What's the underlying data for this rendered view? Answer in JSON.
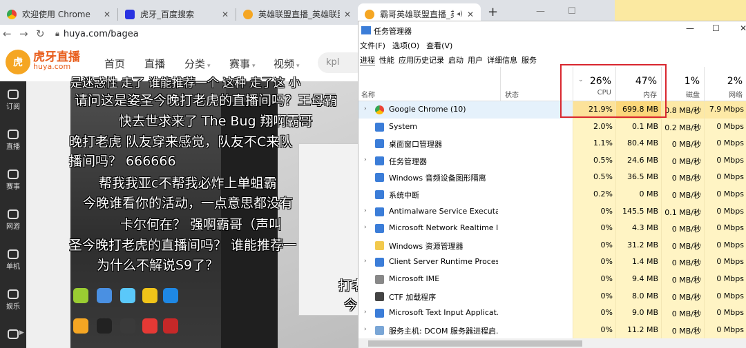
{
  "chrome": {
    "tabs": [
      {
        "title": "欢迎使用 Chrome",
        "icon": "chrome-icon",
        "color": "#4285f4"
      },
      {
        "title": "虎牙_百度搜索",
        "icon": "baidu-paw-icon",
        "color": "#2932e1"
      },
      {
        "title": "英雄联盟直播_英雄联盟え",
        "icon": "huya-icon",
        "color": "#f5a623"
      },
      {
        "title": "霸哥英雄联盟直播_英",
        "icon": "huya-icon",
        "color": "#f5a623",
        "active": true
      }
    ],
    "close": "✕",
    "new_tab": "+",
    "mute_icon": "◂)",
    "address": "huya.com/bagea",
    "window_min": "—",
    "window_max": "☐"
  },
  "huya": {
    "logo_badge": "虎",
    "logo_cn": "虎牙直播",
    "logo_en": "huya.com",
    "nav": [
      {
        "label": "首页"
      },
      {
        "label": "直播"
      },
      {
        "label": "分类",
        "caret": true
      },
      {
        "label": "赛事",
        "caret": true
      },
      {
        "label": "视频",
        "caret": true
      }
    ],
    "caret": "▾",
    "search_text": "kpl",
    "sidebar": [
      {
        "label": "订阅"
      },
      {
        "label": "直播"
      },
      {
        "label": "赛事"
      },
      {
        "label": "网游"
      },
      {
        "label": "单机"
      },
      {
        "label": "娱乐"
      },
      {
        "label": ""
      }
    ],
    "danmaku": [
      "是迷惑性   走了     谁能推荐一个 这种 走了这        小",
      "请问这是姿圣今晚打老虎的直播间吗？王母霸",
      "快去世求来了      The Bug  翔啊霸哥",
      "晚打老虎      队友穿来感觉，队友不C来队",
      "播间吗？                       666666",
      "帮我我亚c不帮我必炸上单蛆霸",
      "今晚谁看你的活动，一点意思都没有",
      "卡尔何在？          强啊霸哥（声叫",
      "圣今晚打老虎的直播间吗？       谁能推荐一",
      "为什么不解说S9了？",
      "打老",
      "今"
    ]
  },
  "taskmgr": {
    "title": "任务管理器",
    "window_buttons": [
      "—",
      "☐",
      "✕"
    ],
    "menu": [
      "文件(F)",
      "选项(O)",
      "查看(V)"
    ],
    "tabs": [
      "进程",
      "性能",
      "应用历史记录",
      "启动",
      "用户",
      "详细信息",
      "服务"
    ],
    "columns": {
      "name": "名称",
      "status": "状态",
      "sort_indicator": "⌄",
      "cpu": {
        "pct": "26%",
        "label": "CPU"
      },
      "mem": {
        "pct": "47%",
        "label": "内存"
      },
      "disk": {
        "pct": "1%",
        "label": "磁盘"
      },
      "net": {
        "pct": "2%",
        "label": "网络"
      }
    },
    "highlight_color": "#d9262e",
    "rows": [
      {
        "name": "Google Chrome (10)",
        "expand": "›",
        "icon": "chrome-icon",
        "cpu": "21.9%",
        "mem": "699.8 MB",
        "disk": "0.8 MB/秒",
        "net": "7.9 Mbps"
      },
      {
        "name": "System",
        "expand": "",
        "icon": "system-icon",
        "cpu": "2.0%",
        "mem": "0.1 MB",
        "disk": "0.2 MB/秒",
        "net": "0 Mbps"
      },
      {
        "name": "桌面窗口管理器",
        "expand": "",
        "icon": "dwm-icon",
        "cpu": "1.1%",
        "mem": "80.4 MB",
        "disk": "0 MB/秒",
        "net": "0 Mbps"
      },
      {
        "name": "任务管理器",
        "expand": "›",
        "icon": "taskmgr-icon",
        "cpu": "0.5%",
        "mem": "24.6 MB",
        "disk": "0 MB/秒",
        "net": "0 Mbps"
      },
      {
        "name": "Windows 音频设备图形隔离",
        "expand": "",
        "icon": "audio-icon",
        "cpu": "0.5%",
        "mem": "36.5 MB",
        "disk": "0 MB/秒",
        "net": "0 Mbps"
      },
      {
        "name": "系统中断",
        "expand": "",
        "icon": "interrupt-icon",
        "cpu": "0.2%",
        "mem": "0 MB",
        "disk": "0 MB/秒",
        "net": "0 Mbps"
      },
      {
        "name": "Antimalware Service Executa...",
        "expand": "›",
        "icon": "shield-icon",
        "cpu": "0%",
        "mem": "145.5 MB",
        "disk": "0.1 MB/秒",
        "net": "0 Mbps"
      },
      {
        "name": "Microsoft Network Realtime I...",
        "expand": "›",
        "icon": "network-icon",
        "cpu": "0%",
        "mem": "4.3 MB",
        "disk": "0 MB/秒",
        "net": "0 Mbps"
      },
      {
        "name": "Windows 资源管理器",
        "expand": "",
        "icon": "folder-icon",
        "cpu": "0%",
        "mem": "31.2 MB",
        "disk": "0 MB/秒",
        "net": "0 Mbps"
      },
      {
        "name": "Client Server Runtime Process",
        "expand": "›",
        "icon": "process-icon",
        "cpu": "0%",
        "mem": "1.4 MB",
        "disk": "0 MB/秒",
        "net": "0 Mbps"
      },
      {
        "name": "Microsoft IME",
        "expand": "",
        "icon": "ime-icon",
        "cpu": "0%",
        "mem": "9.4 MB",
        "disk": "0 MB/秒",
        "net": "0 Mbps"
      },
      {
        "name": "CTF 加载程序",
        "expand": "",
        "icon": "ctf-icon",
        "cpu": "0%",
        "mem": "8.0 MB",
        "disk": "0 MB/秒",
        "net": "0 Mbps"
      },
      {
        "name": "Microsoft Text Input Applicat...",
        "expand": "›",
        "icon": "text-input-icon",
        "cpu": "0%",
        "mem": "9.0 MB",
        "disk": "0 MB/秒",
        "net": "0 Mbps"
      },
      {
        "name": "服务主机: DCOM 服务器进程启...",
        "expand": "›",
        "icon": "service-host-icon",
        "cpu": "0%",
        "mem": "11.2 MB",
        "disk": "0 MB/秒",
        "net": "0 Mbps"
      }
    ]
  }
}
